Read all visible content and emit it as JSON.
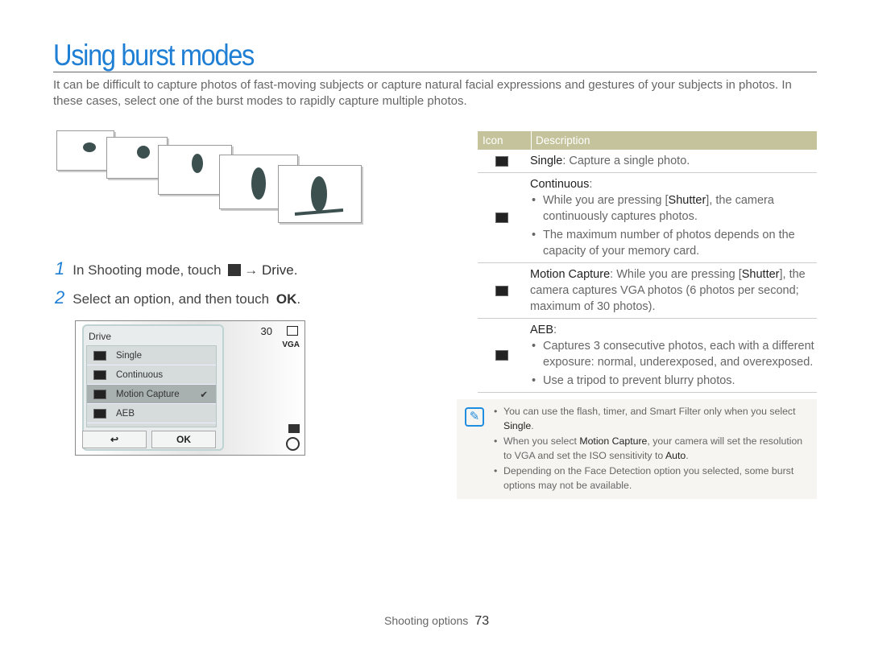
{
  "title": "Using burst modes",
  "intro": "It can be difficult to capture photos of fast-moving subjects or capture natural facial expressions and gestures of your subjects in photos. In these cases, select one of the burst modes to rapidly capture multiple photos.",
  "steps": [
    {
      "num": "1",
      "text": "In Shooting mode, touch",
      "icon": "menu-icon",
      "arrow": "→",
      "target": "Drive",
      "end": "."
    },
    {
      "num": "2",
      "text": "Select an option, and then touch",
      "ok": "OK",
      "end": "."
    }
  ],
  "camera": {
    "menu_title": "Drive",
    "options": [
      {
        "label": "Single"
      },
      {
        "label": "Continuous"
      },
      {
        "label": "Motion Capture",
        "selected": true
      },
      {
        "label": "AEB"
      }
    ],
    "back_label": "↩",
    "ok_label": "OK",
    "shots": "30",
    "resolution": "VGA",
    "check": "✔"
  },
  "table": {
    "headers": [
      "Icon",
      "Description"
    ],
    "rows": [
      {
        "name": "Single",
        "desc": ": Capture a single photo."
      },
      {
        "name": "Continuous",
        "suffix": ":",
        "bullets": [
          "While you are pressing [Shutter], the camera continuously captures photos.",
          "The maximum number of photos depends on the capacity of your memory card."
        ]
      },
      {
        "name": "Motion Capture",
        "desc_a": ": While you are pressing [",
        "key": "Shutter",
        "desc_b": "], the camera captures VGA photos (6 photos per second; maximum of 30 photos)."
      },
      {
        "name": "AEB",
        "suffix": ":",
        "bullets": [
          "Captures 3 consecutive photos, each with a different exposure: normal, underexposed, and overexposed.",
          "Use a tripod to prevent blurry photos."
        ]
      }
    ]
  },
  "note": {
    "items": [
      {
        "a": "You can use the flash, timer, and Smart Filter only when you select ",
        "b": "Single",
        "c": "."
      },
      {
        "a": "When you select ",
        "b": "Motion Capture",
        "c": ", your camera will set the resolution to VGA and set the ISO sensitivity to ",
        "d": "Auto",
        "e": "."
      },
      {
        "a": "Depending on the Face Detection option you selected, some burst options may not be available."
      }
    ]
  },
  "footer": {
    "section": "Shooting options",
    "page": "73"
  },
  "colors": {
    "accent": "#1f7fd4",
    "table_header": "#c4c39c"
  }
}
